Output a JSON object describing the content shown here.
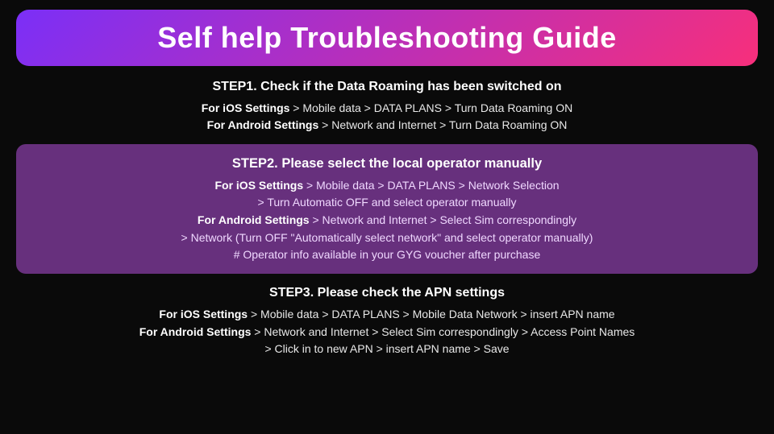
{
  "title": "Self help Troubleshooting Guide",
  "steps": [
    {
      "id": "step1",
      "highlighted": false,
      "title": "STEP1. Check if the Data Roaming has been switched on",
      "lines": [
        {
          "bold": "For iOS Settings",
          "rest": " > Mobile data > DATA PLANS > Turn Data Roaming ON"
        },
        {
          "bold": "For Android Settings",
          "rest": " > Network and Internet > Turn Data Roaming ON"
        }
      ]
    },
    {
      "id": "step2",
      "highlighted": true,
      "title": "STEP2. Please select the local operator manually",
      "lines": [
        {
          "bold": "For iOS Settings",
          "rest": " > Mobile data > DATA PLANS > Network Selection"
        },
        {
          "bold": "",
          "rest": "> Turn Automatic OFF and select operator manually"
        },
        {
          "bold": "For Android Settings",
          "rest": " > Network and Internet > Select Sim correspondingly"
        },
        {
          "bold": "",
          "rest": "> Network (Turn OFF \"Automatically select network\" and select operator manually)"
        },
        {
          "bold": "",
          "rest": "# Operator info available in your GYG voucher after purchase"
        }
      ]
    },
    {
      "id": "step3",
      "highlighted": false,
      "title": "STEP3. Please check the APN settings",
      "lines": [
        {
          "bold": "For iOS Settings",
          "rest": " > Mobile data > DATA PLANS > Mobile Data Network > insert APN name"
        },
        {
          "bold": "For Android Settings",
          "rest": " > Network and Internet > Select Sim correspondingly > Access Point Names"
        },
        {
          "bold": "",
          "rest": "> Click in to new APN > insert APN name > Save"
        }
      ]
    }
  ]
}
